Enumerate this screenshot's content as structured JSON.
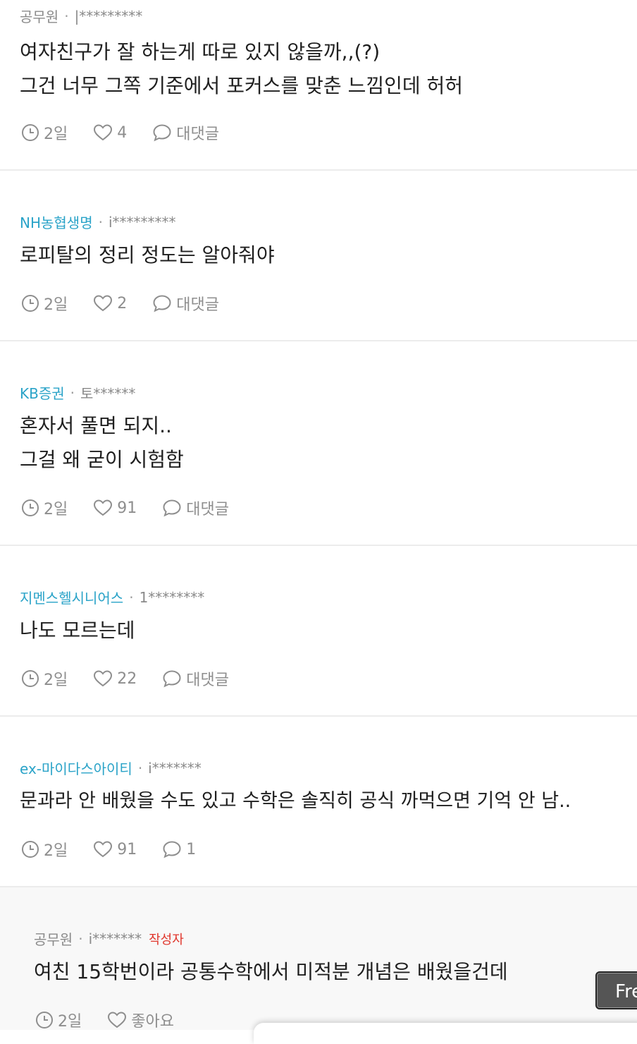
{
  "comments": [
    {
      "company": "공무원",
      "user": "|*********",
      "lines": [
        "여자친구가 잘 하는게 따로 있지 않을까,,(?)",
        "그건 너무 그쪽 기준에서 포커스를 맞춘 느낌인데 허허"
      ],
      "time": "2일",
      "likes": "4",
      "reply": "대댓글"
    },
    {
      "company": "NH농협생명",
      "user": "i*********",
      "lines": [
        "로피탈의 정리 정도는 알아줘야"
      ],
      "time": "2일",
      "likes": "2",
      "reply": "대댓글"
    },
    {
      "company": "KB증권",
      "user": "토******",
      "lines": [
        "혼자서 풀면 되지..",
        "그걸 왜 굳이 시험함"
      ],
      "time": "2일",
      "likes": "91",
      "reply": "대댓글"
    },
    {
      "company": "지멘스헬시니어스",
      "user": "1********",
      "lines": [
        "나도 모르는데"
      ],
      "time": "2일",
      "likes": "22",
      "reply": "대댓글"
    },
    {
      "company": "ex-마이다스아이티",
      "user": "i*******",
      "lines": [
        "문과라 안 배웠을 수도 있고 수학은 솔직히 공식 까먹으면 기억 안 남.."
      ],
      "time": "2일",
      "likes": "91",
      "reply": "1"
    }
  ],
  "reply_comment": {
    "company": "공무원",
    "user": "i*******",
    "author_tag": "작성자",
    "text": "여친 15학번이라 공통수학에서 미적분 개념은 배웠을건데",
    "time": "2일",
    "like_label": "좋아요"
  },
  "floating_button": {
    "label": "Fre"
  },
  "colors": {
    "company_link": "#2aa3c8",
    "author_tag": "#e0352b",
    "meta": "#8a8a8a"
  }
}
